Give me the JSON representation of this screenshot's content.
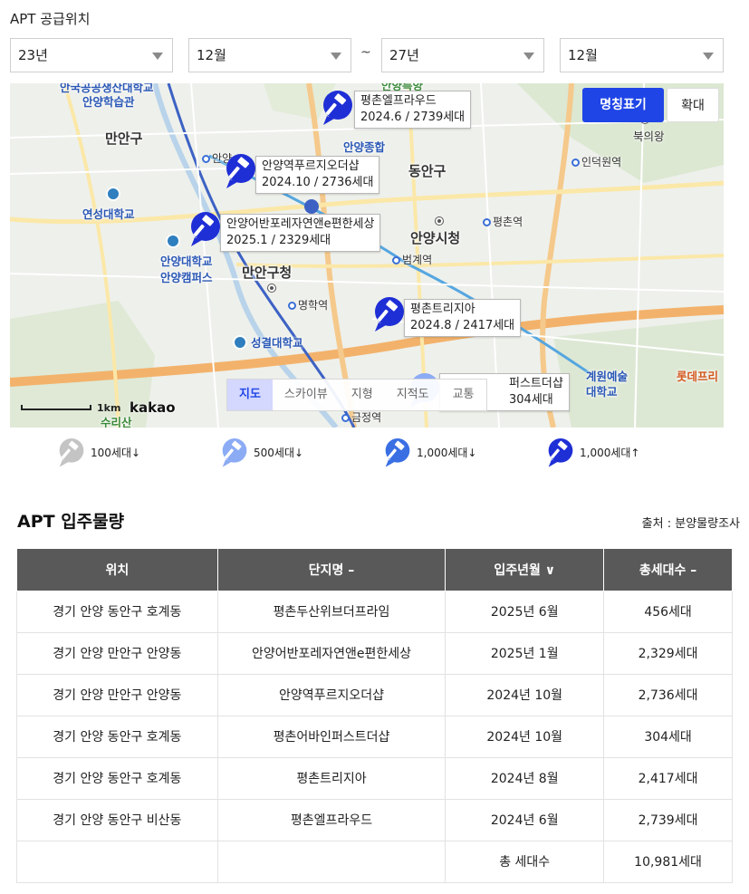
{
  "supply": {
    "title": "APT 공급위치",
    "from_year": "23년",
    "from_month": "12월",
    "separator": "~",
    "to_year": "27년",
    "to_month": "12월"
  },
  "map": {
    "btn_name": "명칭표기",
    "btn_zoom": "확대",
    "districts": {
      "manan_gu": "만안구",
      "dongan_gu": "동안구",
      "city_hall": "안양시청",
      "manan_office": "만안구청"
    },
    "places": {
      "school_top": "안국공공생산대학교",
      "hakseup": "안양학습관",
      "yeonsung": "연성대학교",
      "campus1": "안양대학교",
      "campus2": "안양캠퍼스",
      "sungkyul": "성결대학교",
      "anyang_hosp": "안양종합",
      "arts1": "계원예술",
      "arts2": "대학교",
      "bukhwang": "북의왕",
      "lotte": "롯데프리",
      "suri": "수리산",
      "top_green": "안양특양"
    },
    "stations": {
      "anyang": "안양",
      "indeogwon": "인덕원역",
      "pyeongchon": "평촌역",
      "beomgye": "범계역",
      "myeonghak": "명학역",
      "geumjeong": "금정역"
    },
    "markers": [
      {
        "name": "평촌엘프라우드",
        "info": "2024.6 / 2739세대"
      },
      {
        "name": "안양역푸르지오더샵",
        "info": "2024.10 / 2736세대"
      },
      {
        "name": "안양어반포레자연앤e편한세상",
        "info": "2025.1 / 2329세대"
      },
      {
        "name": "평촌트리지아",
        "info": "2024.8 / 2417세대"
      },
      {
        "name": "퍼스트더샵",
        "info": "304세대"
      }
    ],
    "map_types": [
      "지도",
      "스카이뷰",
      "지형",
      "지적도",
      "교통"
    ],
    "scale_label": "1km",
    "kakao": "kakao"
  },
  "legend": [
    {
      "label": "100세대↓",
      "color": "#c4c4c4"
    },
    {
      "label": "500세대↓",
      "color": "#8cabf5"
    },
    {
      "label": "1,000세대↓",
      "color": "#3a6fe4"
    },
    {
      "label": "1,000세대↑",
      "color": "#1f2fd6"
    }
  ],
  "occupancy": {
    "title": "APT 입주물량",
    "source": "출처 : 분양물량조사",
    "headers": [
      "위치",
      "단지명 –",
      "입주년월 ∨",
      "총세대수 –"
    ],
    "rows": [
      [
        "경기 안양 동안구 호계동",
        "평촌두산위브더프라임",
        "2025년 6월",
        "456세대"
      ],
      [
        "경기 안양 만안구 안양동",
        "안양어반포레자연앤e편한세상",
        "2025년 1월",
        "2,329세대"
      ],
      [
        "경기 안양 만안구 안양동",
        "안양역푸르지오더샵",
        "2024년 10월",
        "2,736세대"
      ],
      [
        "경기 안양 동안구 호계동",
        "평촌어바인퍼스트더샵",
        "2024년 10월",
        "304세대"
      ],
      [
        "경기 안양 동안구 호계동",
        "평촌트리지아",
        "2024년 8월",
        "2,417세대"
      ],
      [
        "경기 안양 동안구 비산동",
        "평촌엘프라우드",
        "2024년 6월",
        "2,739세대"
      ]
    ],
    "total_label": "총 세대수",
    "total_value": "10,981세대"
  },
  "colors": {
    "accent": "#1f45e6",
    "header_bg": "#595959",
    "marker": "#1f2fd6"
  }
}
